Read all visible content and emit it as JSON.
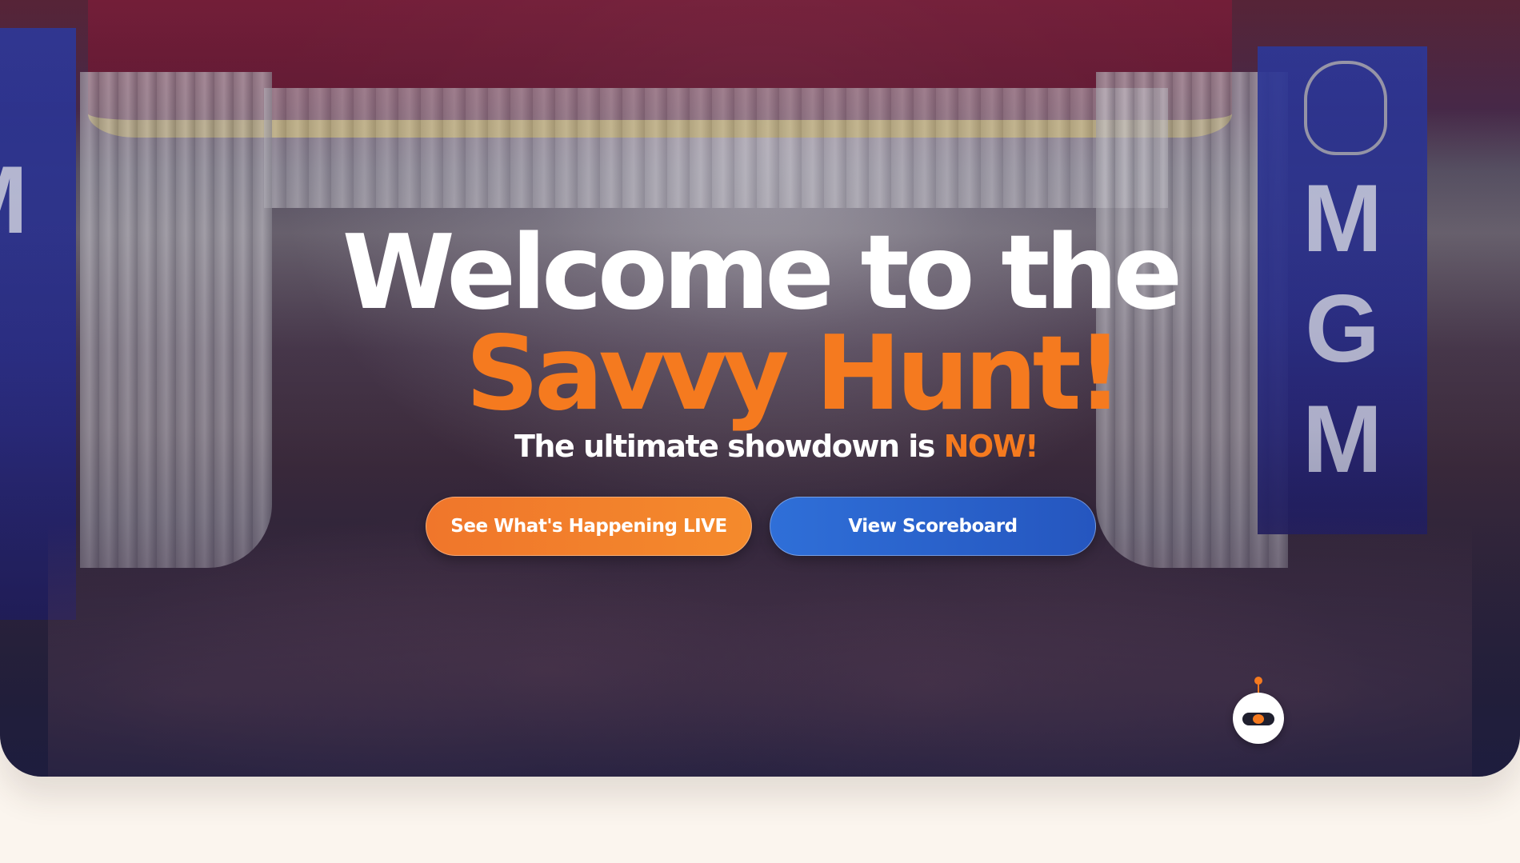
{
  "hero": {
    "title_line1": "Welcome to the",
    "title_line2": "Savvy Hunt!",
    "subtitle_prefix": "The ultimate showdown is ",
    "subtitle_accent": "NOW!",
    "buttons": {
      "live_label": "See What's Happening LIVE",
      "scoreboard_label": "View Scoreboard"
    },
    "banner_letters": [
      "M",
      "G",
      "M"
    ]
  },
  "colors": {
    "accent": "#f57a1f",
    "primary_blue": "#2f6fd8",
    "page_background": "#fbf5ee"
  },
  "chatbot": {
    "icon": "robot-chat-icon"
  }
}
